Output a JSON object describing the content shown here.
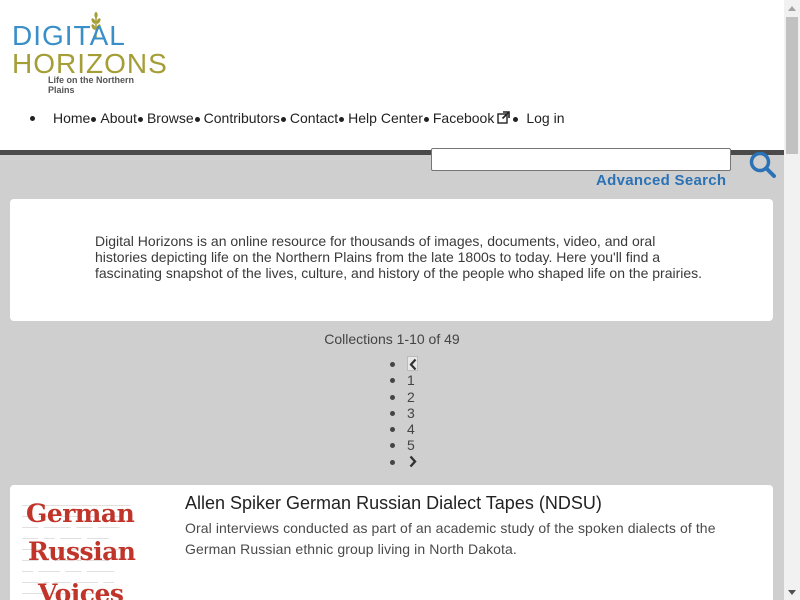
{
  "logo": {
    "line1": "DIGITAL",
    "line2": "HORIZONS",
    "tagline": "Life on the Northern Plains",
    "colors": {
      "blue": "#3a8fc9",
      "gold": "#a59e36"
    }
  },
  "nav": {
    "items": [
      {
        "label": "Home"
      },
      {
        "label": "About"
      },
      {
        "label": "Browse"
      },
      {
        "label": "Contributors"
      },
      {
        "label": "Contact"
      },
      {
        "label": "Help Center"
      },
      {
        "label": "Facebook",
        "icon": "external-link-icon"
      },
      {
        "label": "Log in"
      }
    ]
  },
  "search": {
    "value": "",
    "icon": "search-icon",
    "advanced_label": "Advanced Search"
  },
  "intro": {
    "text": "Digital Horizons is an online resource for thousands of images, documents, video, and oral histories depicting life on the Northern Plains from the late 1800s to today. Here you'll find a fascinating snapshot of the lives, culture, and history of the people who shaped life on the prairies."
  },
  "pager": {
    "summary": "Collections 1-10 of 49",
    "prev_icon": "chevron-left-icon",
    "pages": [
      "1",
      "2",
      "3",
      "4",
      "5"
    ],
    "next_icon": "chevron-right-icon"
  },
  "collections": [
    {
      "title": "Allen Spiker German Russian Dialect Tapes (NDSU)",
      "description": "Oral interviews conducted as part of an academic study of the spoken dialects of the German Russian ethnic group living in North Dakota.",
      "thumbnail_words": [
        "German",
        "Russian",
        "Voices"
      ]
    }
  ],
  "accent_color": "#2a72b5"
}
